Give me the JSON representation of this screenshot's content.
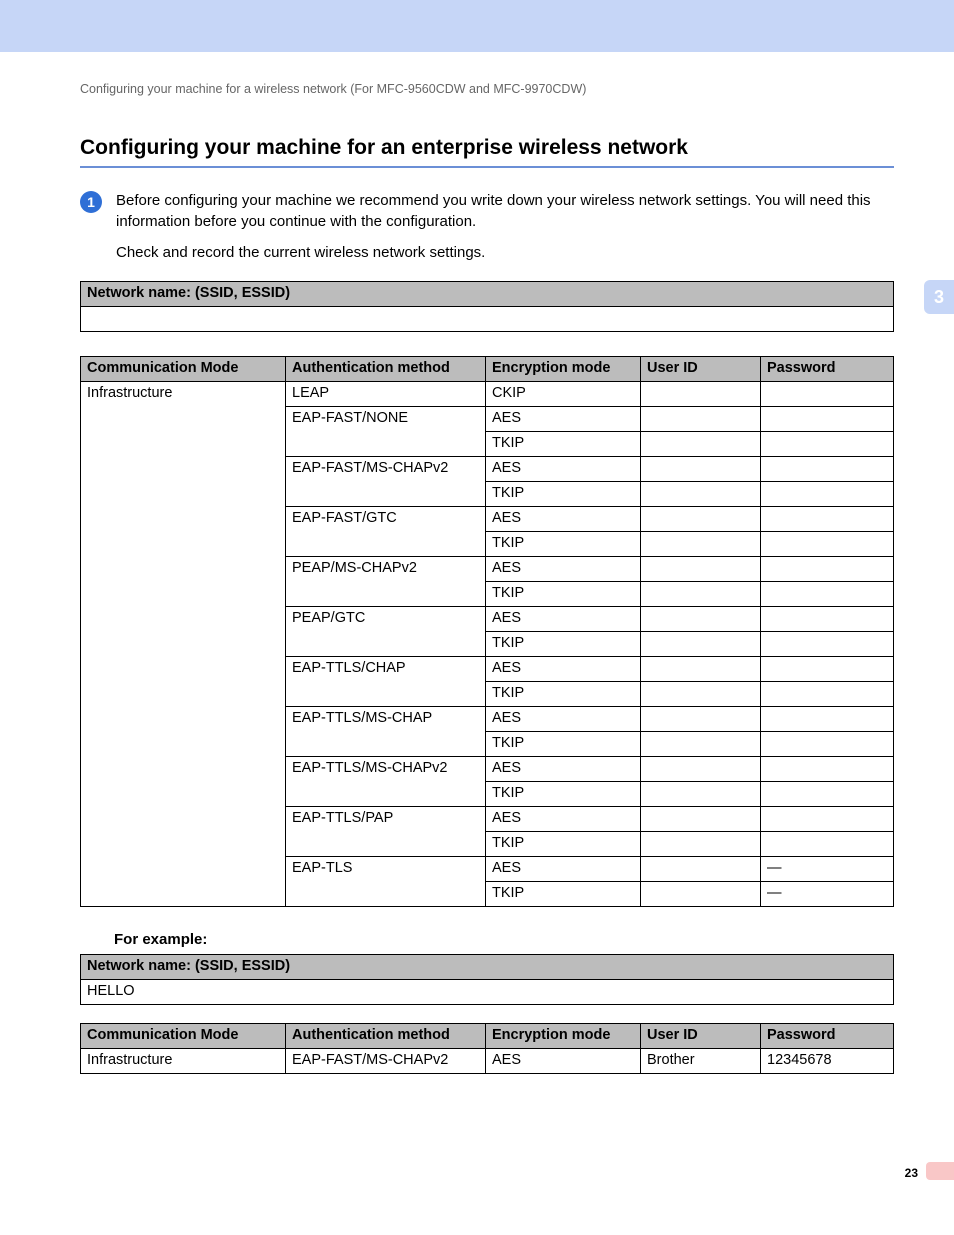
{
  "breadcrumb": "Configuring your machine for a wireless network (For MFC-9560CDW and MFC-9970CDW)",
  "heading": "Configuring your machine for an enterprise wireless network",
  "step": {
    "num": "1",
    "p1": "Before configuring your machine we recommend you write down your wireless network settings. You will need this information before you continue with the configuration.",
    "p2": "Check and record the current wireless network settings."
  },
  "ssid_table": {
    "header": "Network name: (SSID, ESSID)",
    "value": " "
  },
  "main_table": {
    "headers": {
      "comm": "Communication Mode",
      "auth": "Authentication method",
      "enc": "Encryption mode",
      "uid": "User ID",
      "pw": "Password"
    },
    "rows": [
      {
        "comm": "Infrastructure",
        "auth": "LEAP",
        "enc": "CKIP",
        "uid": "",
        "pw": ""
      },
      {
        "comm": "",
        "auth": "EAP-FAST/NONE",
        "enc": "AES",
        "uid": "",
        "pw": ""
      },
      {
        "comm": "",
        "auth": "",
        "enc": "TKIP",
        "uid": "",
        "pw": ""
      },
      {
        "comm": "",
        "auth": "EAP-FAST/MS-CHAPv2",
        "enc": "AES",
        "uid": "",
        "pw": ""
      },
      {
        "comm": "",
        "auth": "",
        "enc": "TKIP",
        "uid": "",
        "pw": ""
      },
      {
        "comm": "",
        "auth": "EAP-FAST/GTC",
        "enc": "AES",
        "uid": "",
        "pw": ""
      },
      {
        "comm": "",
        "auth": "",
        "enc": "TKIP",
        "uid": "",
        "pw": ""
      },
      {
        "comm": "",
        "auth": "PEAP/MS-CHAPv2",
        "enc": "AES",
        "uid": "",
        "pw": ""
      },
      {
        "comm": "",
        "auth": "",
        "enc": "TKIP",
        "uid": "",
        "pw": ""
      },
      {
        "comm": "",
        "auth": "PEAP/GTC",
        "enc": "AES",
        "uid": "",
        "pw": ""
      },
      {
        "comm": "",
        "auth": "",
        "enc": "TKIP",
        "uid": "",
        "pw": ""
      },
      {
        "comm": "",
        "auth": "EAP-TTLS/CHAP",
        "enc": "AES",
        "uid": "",
        "pw": ""
      },
      {
        "comm": "",
        "auth": "",
        "enc": "TKIP",
        "uid": "",
        "pw": ""
      },
      {
        "comm": "",
        "auth": "EAP-TTLS/MS-CHAP",
        "enc": "AES",
        "uid": "",
        "pw": ""
      },
      {
        "comm": "",
        "auth": "",
        "enc": "TKIP",
        "uid": "",
        "pw": ""
      },
      {
        "comm": "",
        "auth": "EAP-TTLS/MS-CHAPv2",
        "enc": "AES",
        "uid": "",
        "pw": ""
      },
      {
        "comm": "",
        "auth": "",
        "enc": "TKIP",
        "uid": "",
        "pw": ""
      },
      {
        "comm": "",
        "auth": "EAP-TTLS/PAP",
        "enc": "AES",
        "uid": "",
        "pw": ""
      },
      {
        "comm": "",
        "auth": "",
        "enc": "TKIP",
        "uid": "",
        "pw": ""
      },
      {
        "comm": "",
        "auth": "EAP-TLS",
        "enc": "AES",
        "uid": "",
        "pw": "—"
      },
      {
        "comm": "",
        "auth": "",
        "enc": "TKIP",
        "uid": "",
        "pw": "—"
      }
    ]
  },
  "for_example": "For example:",
  "ex_ssid_table": {
    "header": "Network name: (SSID, ESSID)",
    "value": "HELLO"
  },
  "ex_table": {
    "headers": {
      "comm": "Communication Mode",
      "auth": "Authentication method",
      "enc": "Encryption mode",
      "uid": "User ID",
      "pw": "Password"
    },
    "row": {
      "comm": "Infrastructure",
      "auth": "EAP-FAST/MS-CHAPv2",
      "enc": "AES",
      "uid": "Brother",
      "pw": "12345678"
    }
  },
  "chapter_tab": "3",
  "page_num": "23"
}
